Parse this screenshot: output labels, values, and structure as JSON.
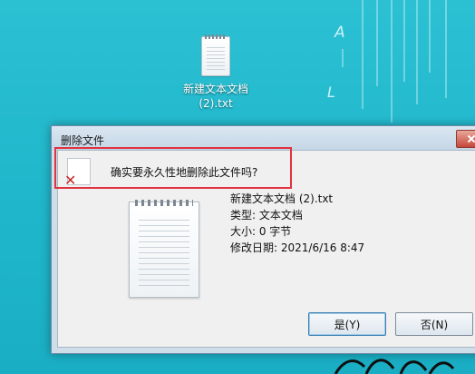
{
  "desktop": {
    "icon": {
      "label_line1": "新建文本文档",
      "label_line2": "(2).txt"
    },
    "decor_letters": [
      "A",
      "L"
    ]
  },
  "dialog": {
    "title": "删除文件",
    "question": "确实要永久性地删除此文件吗?",
    "file_name": "新建文本文档 (2).txt",
    "type": "类型: 文本文档",
    "size": "大小: 0 字节",
    "modified": "修改日期: 2021/6/16 8:47",
    "buttons": {
      "yes": "是(Y)",
      "no": "否(N)"
    }
  },
  "colors": {
    "desktop": "#22b8cc",
    "highlight": "#e0323f",
    "close_button": "#c7473a"
  },
  "icons": [
    "text-file-icon",
    "delete-warning-icon",
    "close-icon"
  ]
}
